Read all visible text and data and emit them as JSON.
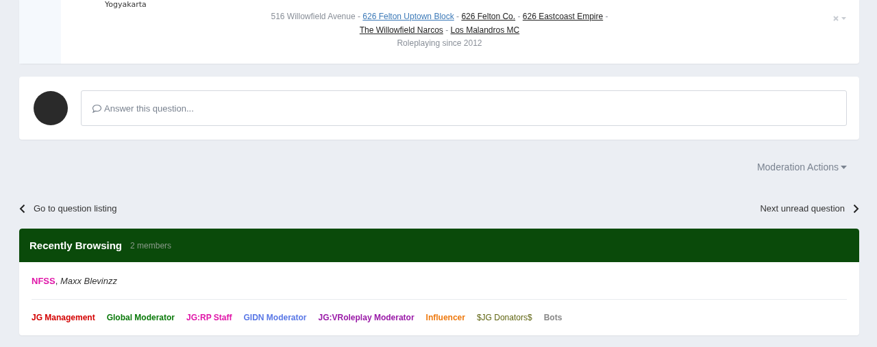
{
  "post": {
    "location": "Yogyakarta",
    "signature": [
      [
        {
          "kind": "plain",
          "text": "516 Willowfield Avenue - "
        },
        {
          "kind": "link",
          "text": "626 Felton Uptown Block",
          "color": "#3d7ab8"
        },
        {
          "kind": "plain",
          "text": " - "
        },
        {
          "kind": "link",
          "text": "626 Felton Co.",
          "color": "#222222"
        },
        {
          "kind": "plain",
          "text": " - "
        },
        {
          "kind": "link",
          "text": "626 Eastcoast Empire",
          "color": "#222222"
        },
        {
          "kind": "plain",
          "text": " -"
        }
      ],
      [
        {
          "kind": "link",
          "text": "The Willowfield Narcos",
          "color": "#222222"
        },
        {
          "kind": "plain",
          "text": " - "
        },
        {
          "kind": "link",
          "text": "Los Malandros MC",
          "color": "#222222"
        }
      ],
      [
        {
          "kind": "plain",
          "text": "Roleplaying since 2012"
        }
      ]
    ]
  },
  "reply": {
    "placeholder": "Answer this question..."
  },
  "moderation_actions": "Moderation Actions",
  "pagination": {
    "previous": "Go to question listing",
    "next": "Next unread question"
  },
  "recently_browsing": {
    "title": "Recently Browsing",
    "count": "2 members",
    "separator": ", ",
    "members": [
      {
        "name": "NFSS",
        "kind": "group",
        "color": "#e016a8"
      },
      {
        "name": "Maxx Blevinzz",
        "kind": "anonymous"
      }
    ],
    "legend": [
      {
        "label": "JG Management",
        "color": "#d40000",
        "bold": true
      },
      {
        "label": "Global Moderator",
        "color": "#0b7a0b",
        "bold": true
      },
      {
        "label": "JG:RP Staff",
        "color": "#e016a8",
        "bold": true
      },
      {
        "label": "GIDN Moderator",
        "color": "#5a78e6",
        "bold": true
      },
      {
        "label": "JG:VRoleplay Moderator",
        "color": "#9a1aa8",
        "bold": true
      },
      {
        "label": "Influencer",
        "color": "#ee7a10",
        "bold": true
      },
      {
        "label": "$JG Donators$",
        "color": "#5f6410",
        "bold": false
      },
      {
        "label": "Bots",
        "color": "#888888",
        "bold": true
      }
    ]
  }
}
